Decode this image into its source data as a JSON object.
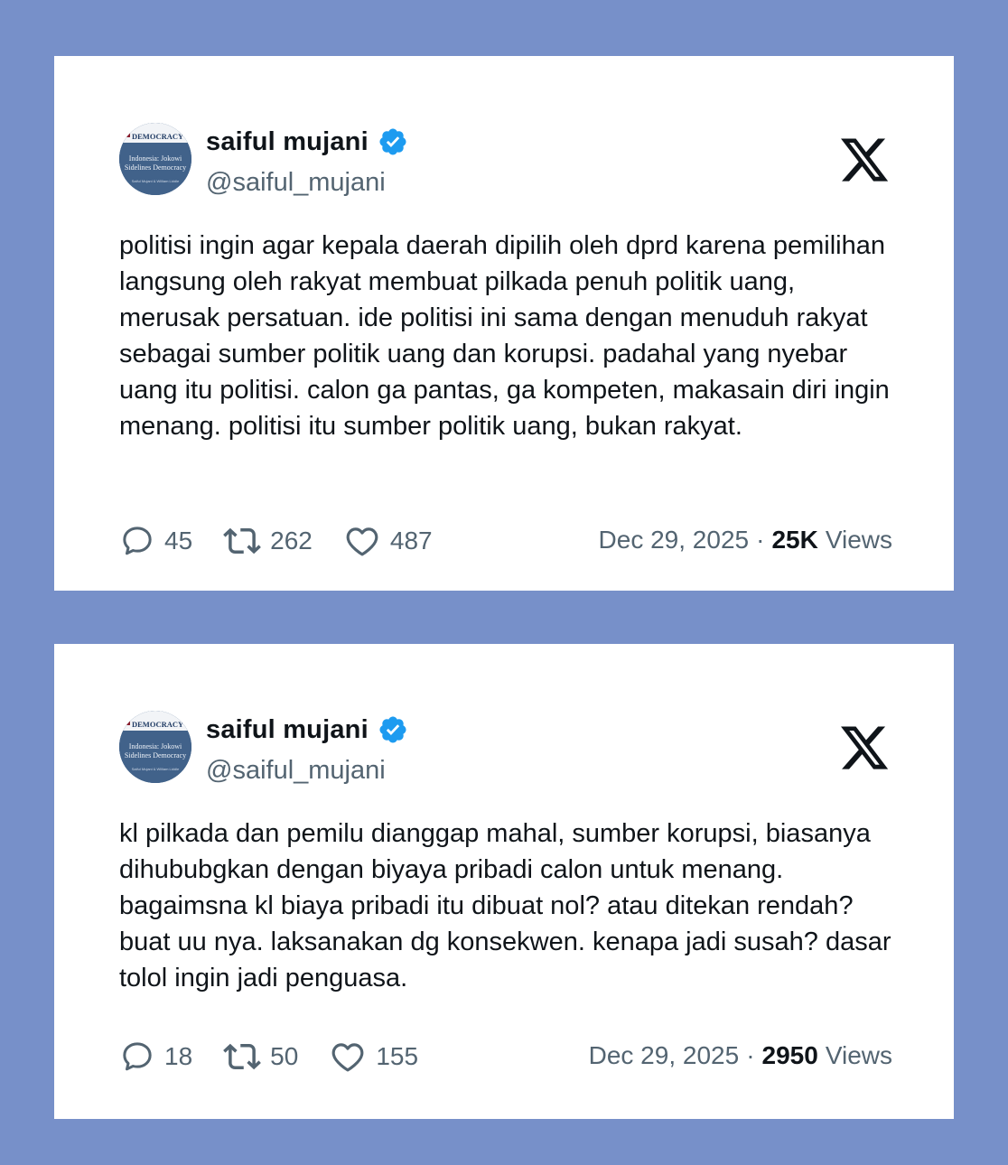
{
  "colors": {
    "background": "#7790c9",
    "card": "#ffffff",
    "text": "#0f1419",
    "muted": "#536471",
    "verified": "#1d9bf0"
  },
  "tweets": [
    {
      "author": {
        "name": "saiful mujani",
        "handle": "@saiful_mujani",
        "avatar": {
          "brand": "DEMOCRACY",
          "line1": "Indonesia: Jokowi",
          "line2": "Sidelines Democracy",
          "line3": "Saiful Mujani & William Liddle"
        }
      },
      "text": "politisi ingin agar kepala daerah dipilih oleh dprd karena pemilihan langsung oleh rakyat membuat pilkada penuh politik uang, merusak persatuan. ide politisi ini sama dengan menuduh rakyat sebagai sumber politik uang dan korupsi. padahal yang nyebar uang itu politisi. calon ga pantas, ga kompeten, makasain diri ingin menang. politisi itu sumber politik uang, bukan rakyat.",
      "replies": "45",
      "retweets": "262",
      "likes": "487",
      "date": "Dec 29, 2025",
      "separator": "·",
      "views_count": "25K",
      "views_label": "Views"
    },
    {
      "author": {
        "name": "saiful mujani",
        "handle": "@saiful_mujani",
        "avatar": {
          "brand": "DEMOCRACY",
          "line1": "Indonesia: Jokowi",
          "line2": "Sidelines Democracy",
          "line3": "Saiful Mujani & William Liddle"
        }
      },
      "text": "kl pilkada dan pemilu dianggap mahal, sumber korupsi, biasanya dihububgkan dengan biyaya pribadi calon untuk menang. bagaimsna kl biaya pribadi itu dibuat nol? atau ditekan rendah? buat uu nya. laksanakan dg konsekwen. kenapa jadi susah? dasar tolol ingin jadi penguasa.",
      "replies": "18",
      "retweets": "50",
      "likes": "155",
      "date": "Dec 29, 2025",
      "separator": "·",
      "views_count": "2950",
      "views_label": "Views"
    }
  ]
}
